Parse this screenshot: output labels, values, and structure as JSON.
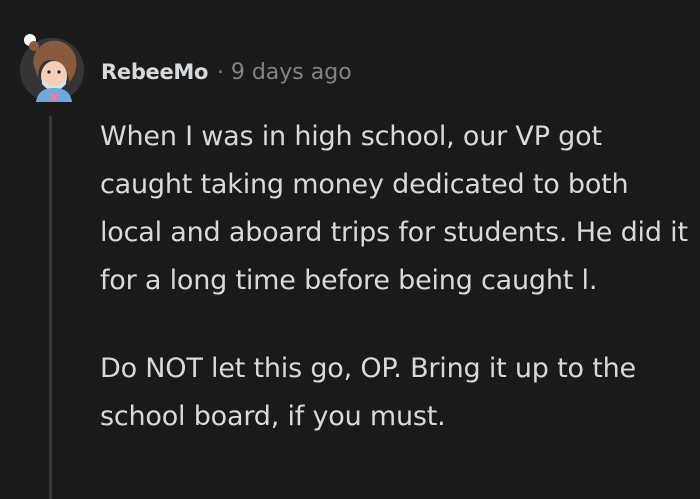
{
  "comment": {
    "author": "RebeeMo",
    "separator": "·",
    "timestamp": "9 days ago",
    "paragraphs": [
      "When I was in high school, our VP got caught taking money dedicated to both local and aboard trips for students. He did it for a long time before being caught l.",
      "Do NOT let this go, OP. Bring it up to the school board, if you must."
    ],
    "avatar_icon": "user-avatar-icon"
  },
  "colors": {
    "background": "#1a1a1b",
    "text": "#d7dadc",
    "muted": "#818384",
    "thread_line": "#343536"
  }
}
